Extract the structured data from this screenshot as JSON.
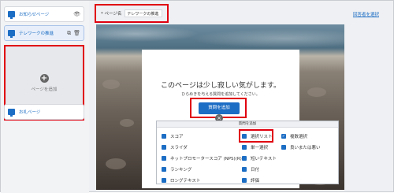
{
  "sidebar": {
    "pages": [
      {
        "label": "お知らせページ",
        "right_icon": "eye-icon"
      },
      {
        "label": "テレワークの推進",
        "right_icon": "copy-and-delete-icons"
      },
      {
        "label": "お礼ページ",
        "right_icon": ""
      }
    ],
    "add_page_label": "ページを追加"
  },
  "topbar": {
    "page_name_label": "* ページ名",
    "page_name_value": "テレワークの推進",
    "hide_title_link": "回答者を選択"
  },
  "card": {
    "title": "このページは少し寂しい気がします。",
    "subtitle": "ひらめきを与える質問を追加してください。",
    "add_section_button": "質問を追加"
  },
  "menu": {
    "header": "質問を追加",
    "items": {
      "col1": [
        "スコア",
        "スライダ",
        "ネットプロモータースコア (NPS)(R)",
        "ランキング",
        "ロングテキスト"
      ],
      "col2": [
        "選択リスト",
        "単一選択",
        "短いテキスト",
        "日付",
        "評価"
      ],
      "col3": [
        "複数選択",
        "良いまたは悪い"
      ]
    }
  },
  "colors": {
    "accent": "#1c6dc4",
    "highlight": "#e0000f"
  }
}
